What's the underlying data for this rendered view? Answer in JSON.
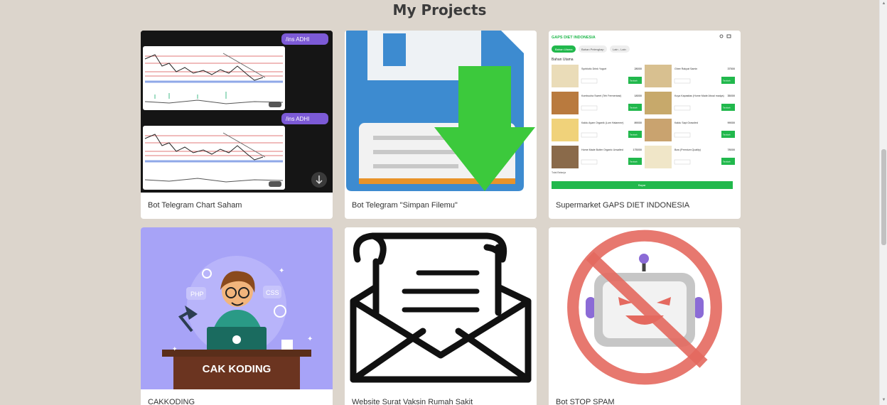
{
  "page": {
    "title": "My Projects"
  },
  "projects": [
    {
      "title": "Bot Telegram Chart Saham",
      "thumb": {
        "badge1": "/ins ADHI",
        "badge2": "/ins ADHI"
      }
    },
    {
      "title": "Bot Telegram \"Simpan Filemu\""
    },
    {
      "title": "Supermarket GAPS DIET INDONESIA",
      "thumb": {
        "brand": "GAPS DIET INDONESIA",
        "tabs": [
          "Bahan Utama",
          "Bahan Pelengkap",
          "Lain - Lain"
        ],
        "section": "Bahan Utama",
        "items": [
          {
            "name": "Synbiotic Drink Yogurt",
            "price": "28000"
          },
          {
            "name": "Ghee Rakyat Samin",
            "price": "37500"
          },
          {
            "name": "Kombucha Sweet (Teh Fermentasi)",
            "price": "18000"
          },
          {
            "name": "Kuya Kapasitas (Home Made Aboal madya)",
            "price": "35000"
          },
          {
            "name": "Kaldu Ayam Organik (Lum Halamme)",
            "price": "89000"
          },
          {
            "name": "Kaldu Sapi Grassfed",
            "price": "99000"
          },
          {
            "name": "Home Made Butter Organic Unsalted",
            "price": "175000"
          },
          {
            "name": "Bow (Premium Quality)",
            "price": "78000"
          }
        ],
        "button": "Tambah",
        "total_label": "Total Belanja",
        "checkout": "Bayar"
      }
    },
    {
      "title": "CAKKODING",
      "thumb": {
        "banner": "CAK KODING",
        "php": "PHP",
        "css": "CSS"
      }
    },
    {
      "title": "Website Surat Vaksin Rumah Sakit"
    },
    {
      "title": "Bot STOP SPAM"
    }
  ],
  "colors": {
    "background": "#dcd5cc",
    "card": "#ffffff",
    "telegram_dark": "#121212",
    "save_blue": "#3d8bd0",
    "save_arrow": "#3cc93c",
    "gaps_green": "#21b84c",
    "cak_purple": "#a7a3f7",
    "spam_red": "#e4695f"
  }
}
